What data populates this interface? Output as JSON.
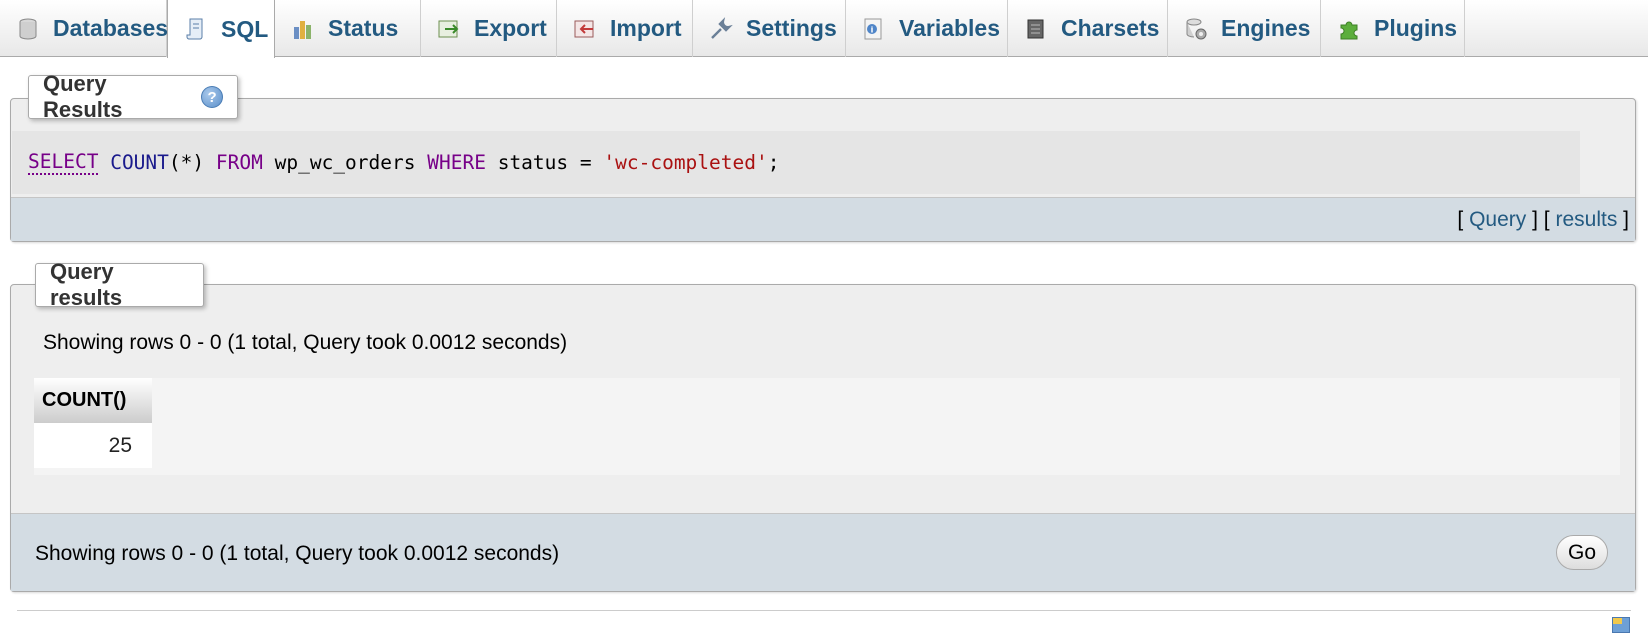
{
  "tabs": [
    {
      "label": "Databases",
      "icon": "database-icon",
      "active": false
    },
    {
      "label": "SQL",
      "icon": "sql-scroll-icon",
      "active": true
    },
    {
      "label": "Status",
      "icon": "status-chart-icon",
      "active": false
    },
    {
      "label": "Export",
      "icon": "export-icon",
      "active": false
    },
    {
      "label": "Import",
      "icon": "import-icon",
      "active": false
    },
    {
      "label": "Settings",
      "icon": "wrench-icon",
      "active": false
    },
    {
      "label": "Variables",
      "icon": "variables-icon",
      "active": false
    },
    {
      "label": "Charsets",
      "icon": "charsets-icon",
      "active": false
    },
    {
      "label": "Engines",
      "icon": "engines-icon",
      "active": false
    },
    {
      "label": "Plugins",
      "icon": "puzzle-icon",
      "active": false
    }
  ],
  "query_panel": {
    "legend": "Query Results",
    "help_glyph": "?",
    "sql": {
      "select": "SELECT",
      "count": "COUNT",
      "paren": "(*)",
      "from": "FROM",
      "table": "wp_wc_orders",
      "where": "WHERE",
      "condition": "status =",
      "value": "'wc-completed'",
      "end": ";"
    },
    "links": {
      "open_bracket": "[ ",
      "query": "Query",
      "middle": " ] [ ",
      "results": "results",
      "close_bracket": " ]"
    }
  },
  "results_panel": {
    "legend": "Query results",
    "showing_top": "Showing rows 0 - 0 (1 total, Query took 0.0012 seconds)",
    "columns": [
      "COUNT()"
    ],
    "rows": [
      [
        "25"
      ]
    ],
    "showing_bottom": "Showing rows 0 - 0 (1 total, Query took 0.0012 seconds)",
    "go_label": "Go"
  },
  "colors": {
    "tab_text": "#235a81",
    "keyword": "#770088",
    "string": "#aa1111",
    "footer_bg": "#d3dce3"
  }
}
